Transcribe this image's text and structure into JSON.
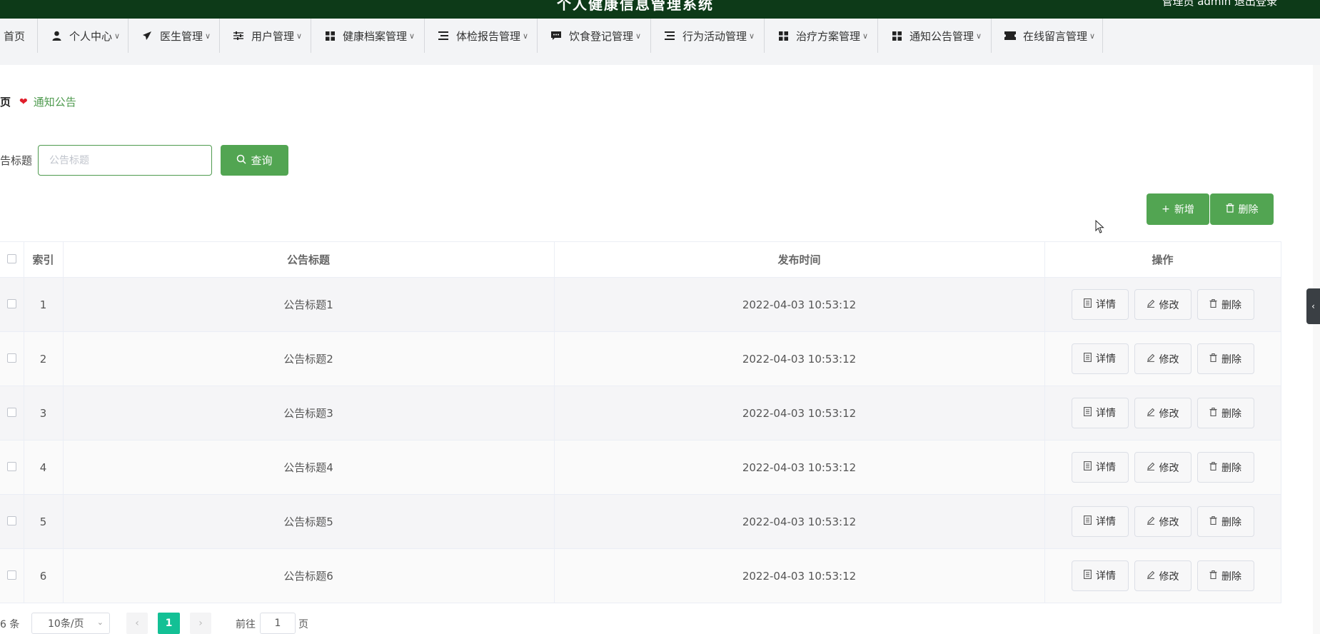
{
  "app": {
    "title": "个人健康信息管理系统",
    "user_text": "管理员 admin  退出登录"
  },
  "nav": [
    {
      "label": "首页",
      "icon": "none"
    },
    {
      "label": "个人中心",
      "icon": "user-icon"
    },
    {
      "label": "医生管理",
      "icon": "paper-plane-icon"
    },
    {
      "label": "用户管理",
      "icon": "sliders-icon"
    },
    {
      "label": "健康档案管理",
      "icon": "grid-icon"
    },
    {
      "label": "体检报告管理",
      "icon": "list-icon"
    },
    {
      "label": "饮食登记管理",
      "icon": "chat-icon"
    },
    {
      "label": "行为活动管理",
      "icon": "list-icon"
    },
    {
      "label": "治疗方案管理",
      "icon": "grid-icon"
    },
    {
      "label": "通知公告管理",
      "icon": "grid-icon"
    },
    {
      "label": "在线留言管理",
      "icon": "ticket-icon"
    }
  ],
  "breadcrumb": {
    "home": "页",
    "current": "通知公告"
  },
  "search": {
    "label": "告标题",
    "placeholder": "公告标题",
    "button": "查询"
  },
  "toolbar": {
    "add": "新增",
    "delete": "删除"
  },
  "table": {
    "headers": {
      "index": "索引",
      "title": "公告标题",
      "time": "发布时间",
      "actions": "操作"
    },
    "rows": [
      {
        "index": "1",
        "title": "公告标题1",
        "time": "2022-04-03 10:53:12"
      },
      {
        "index": "2",
        "title": "公告标题2",
        "time": "2022-04-03 10:53:12"
      },
      {
        "index": "3",
        "title": "公告标题3",
        "time": "2022-04-03 10:53:12"
      },
      {
        "index": "4",
        "title": "公告标题4",
        "time": "2022-04-03 10:53:12"
      },
      {
        "index": "5",
        "title": "公告标题5",
        "time": "2022-04-03 10:53:12"
      },
      {
        "index": "6",
        "title": "公告标题6",
        "time": "2022-04-03 10:53:12"
      }
    ],
    "actions": {
      "detail": "详情",
      "edit": "修改",
      "delete": "删除"
    }
  },
  "pagination": {
    "total": "6 条",
    "page_size": "10条/页",
    "current_page": "1",
    "goto_label": "前往",
    "goto_value": "1",
    "page_suffix": "页"
  }
}
